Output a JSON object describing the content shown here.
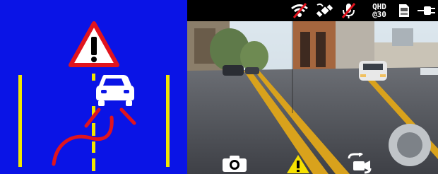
{
  "status_bar": {
    "icons": [
      "wifi-off-icon",
      "gps-icon",
      "mic-muted-icon",
      "resolution-icon",
      "sd-card-icon",
      "power-plug-icon"
    ],
    "resolution_line1": "QHD",
    "resolution_line2": "@30"
  },
  "warning_panel": {
    "icons": [
      "warning-triangle-icon",
      "car-icon",
      "lane-departure-path-icon"
    ],
    "colors": {
      "background": "#0a14e6",
      "lane_line": "#f2e600",
      "center_line": "#f2e600",
      "path": "#e0141e",
      "warning_fill": "#ffffff",
      "warning_border": "#e0141e"
    }
  },
  "controls": {
    "icons": [
      "camera-icon",
      "warning-icon",
      "switch-camera-icon"
    ]
  }
}
